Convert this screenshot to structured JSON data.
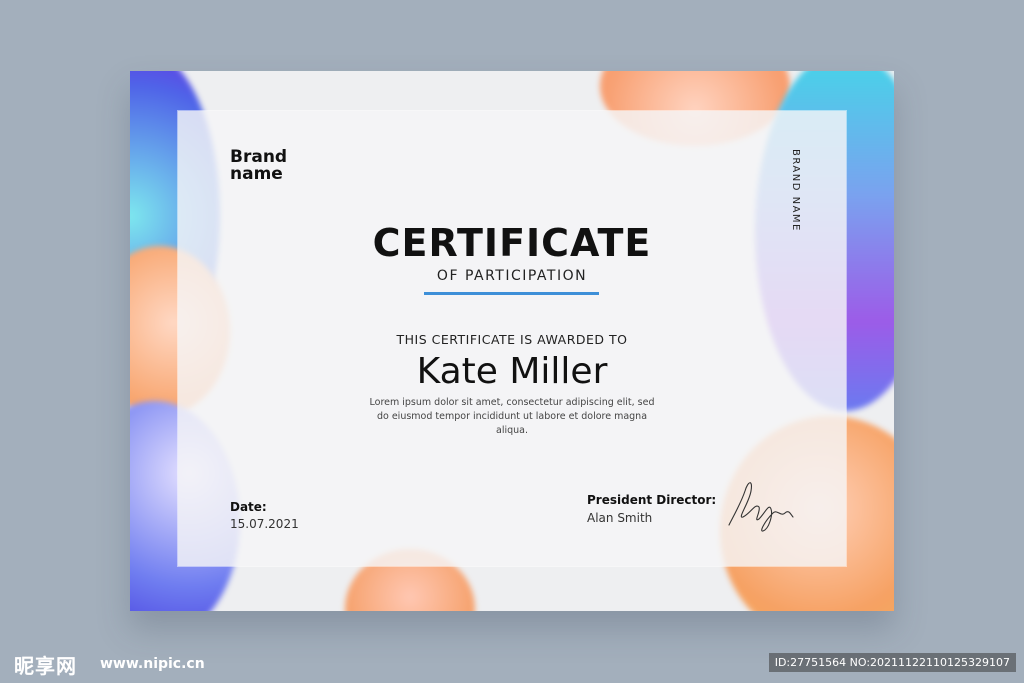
{
  "certificate": {
    "brand": [
      "Brand",
      "name"
    ],
    "brand_vertical": "BRAND NAME",
    "title": "CERTIFICATE",
    "subtitle": "OF PARTICIPATION",
    "awarded_to_label": "THIS CERTIFICATE IS AWARDED TO",
    "recipient": "Kate Miller",
    "body_lines": [
      "Lorem ipsum dolor sit amet, consectetur adipiscing elit, sed",
      "do eiusmod tempor incididunt ut labore et dolore magna",
      "aliqua."
    ],
    "date_label": "Date:",
    "date_value": "15.07.2021",
    "signer_title": "President Director:",
    "signer_name": "Alan Smith"
  },
  "watermark": {
    "logo": "昵享网",
    "url": "www.nipic.cn",
    "id": "ID:27751564 NO:20211122110125329107"
  },
  "colors": {
    "background": "#a3afbc",
    "paper": "#eeeff1",
    "accent_rule": "#3d8fd8",
    "text": "#111111"
  }
}
